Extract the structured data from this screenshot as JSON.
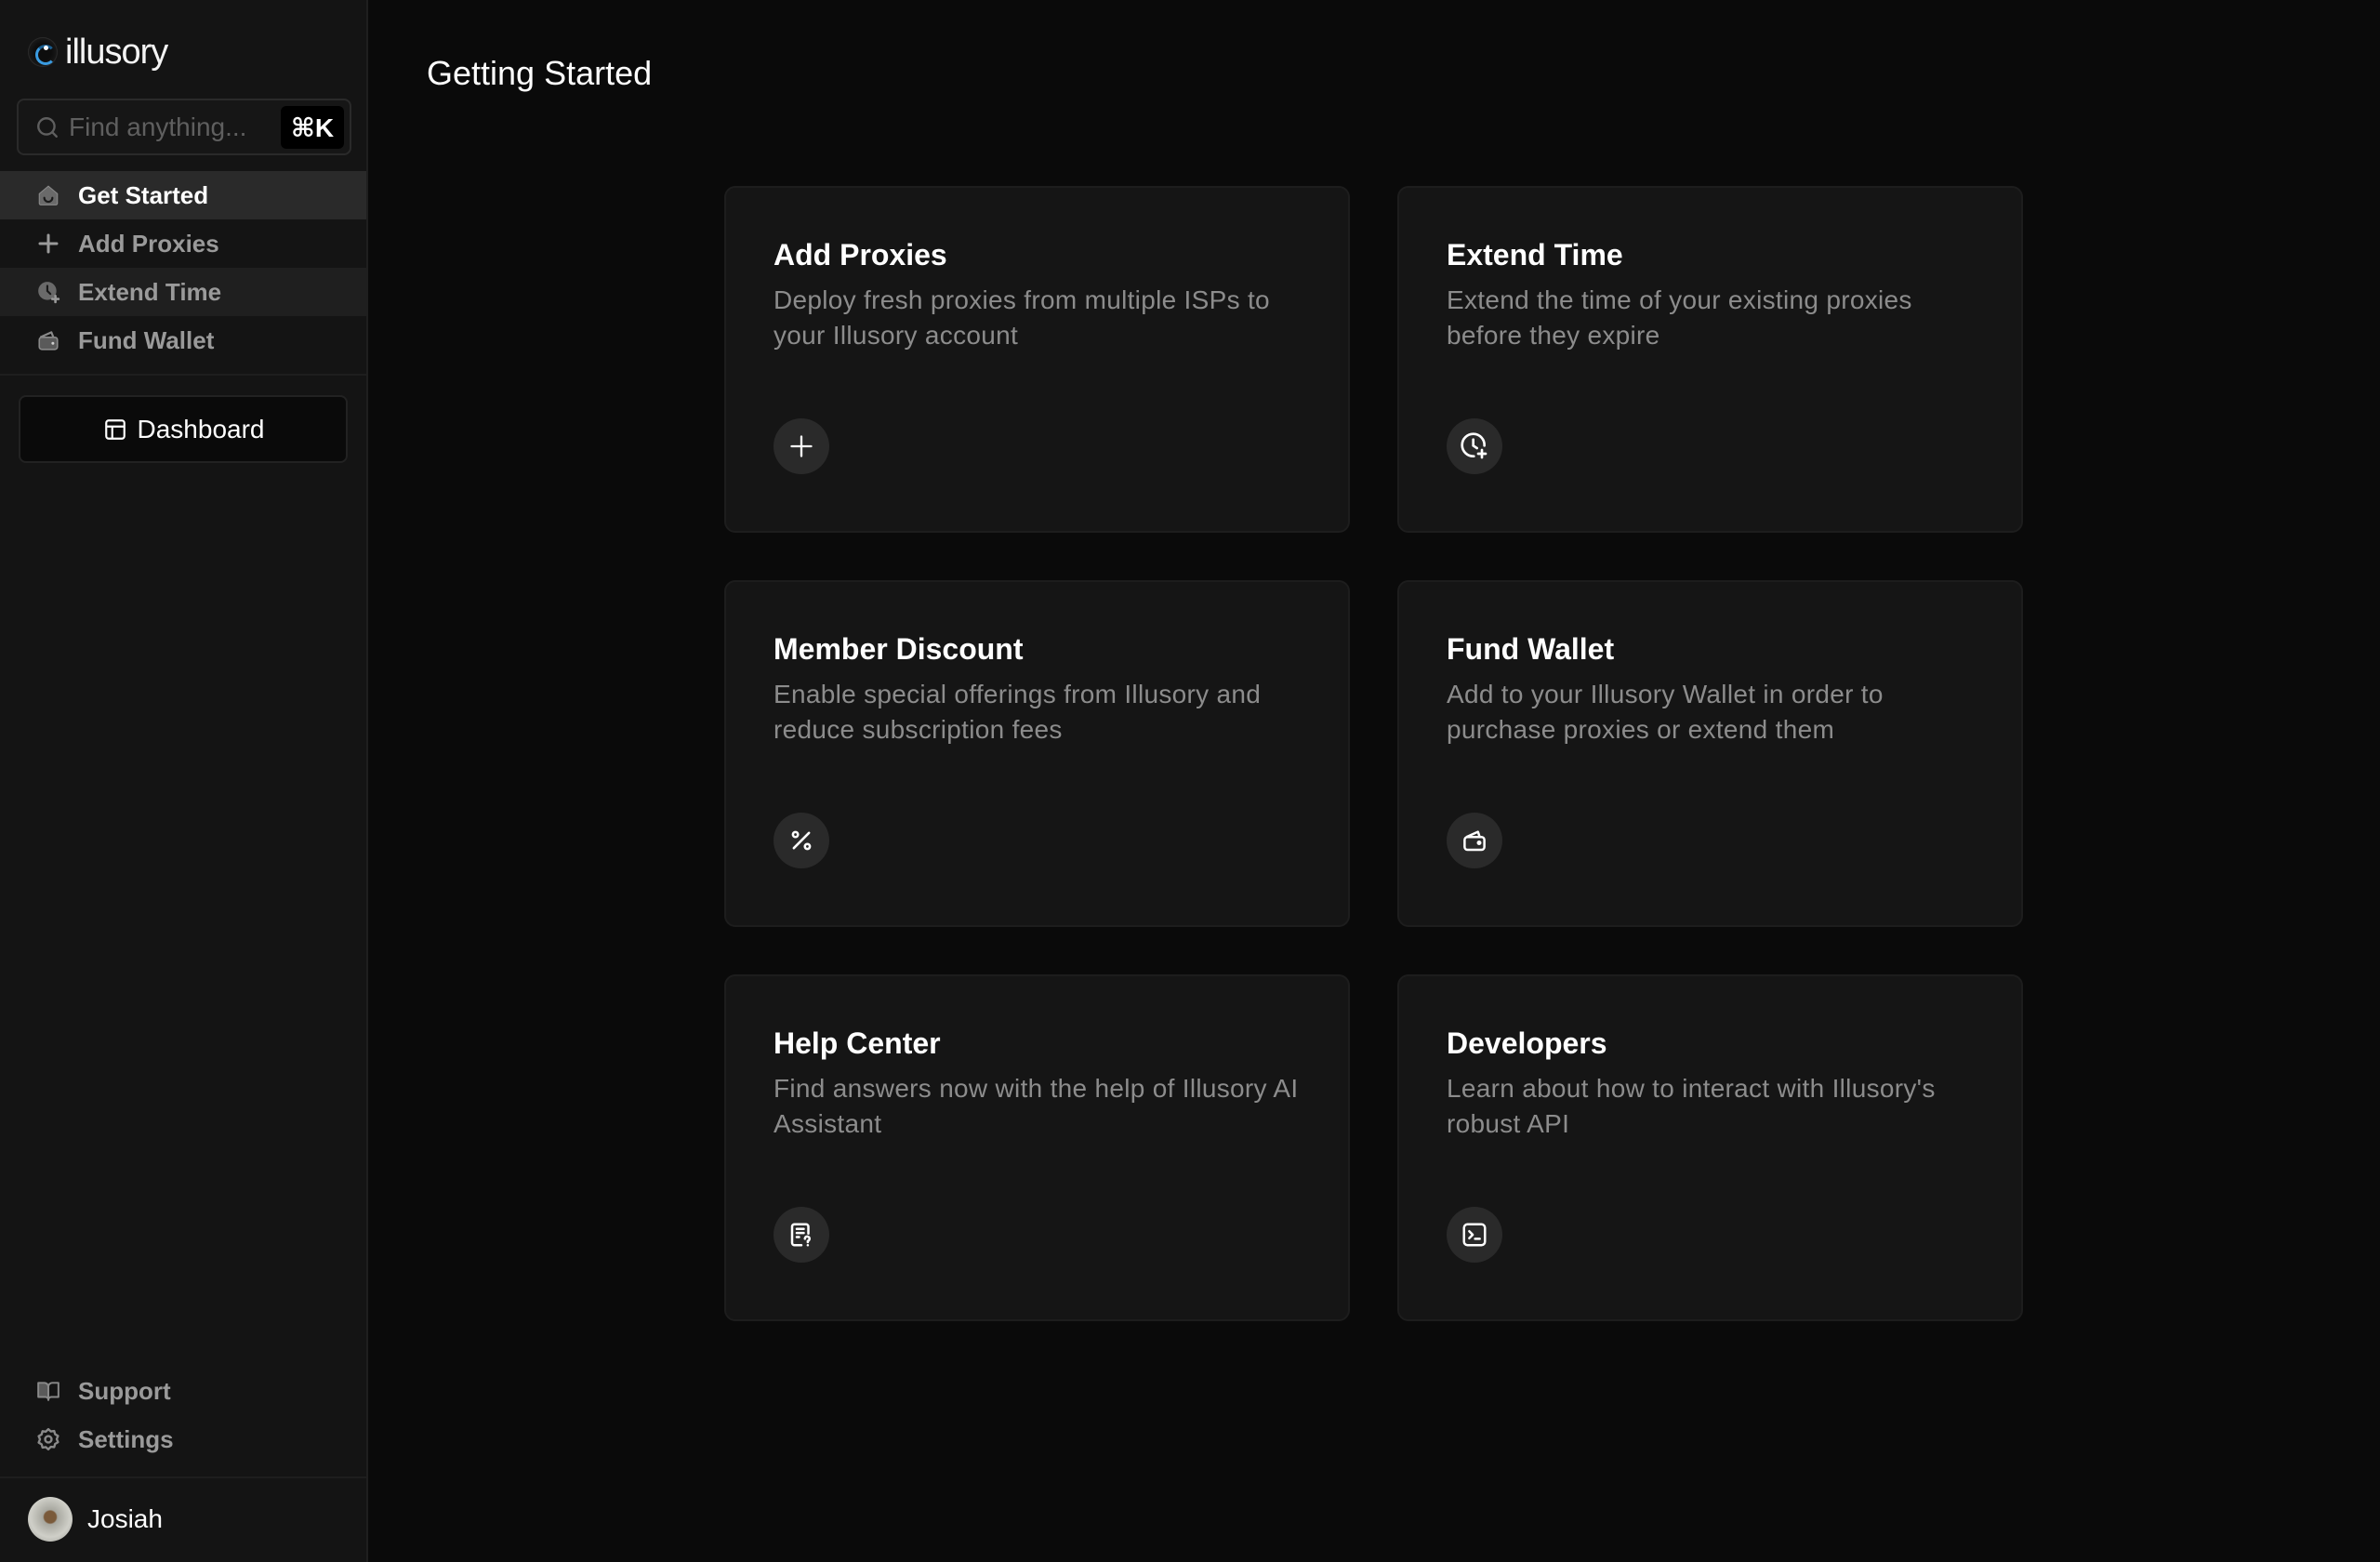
{
  "app": {
    "name": "illusory",
    "logo_icon": "eye-logo-icon"
  },
  "search": {
    "placeholder": "Find anything...",
    "value": "",
    "shortcut": "⌘K",
    "icon": "search-icon"
  },
  "sidebar": {
    "items": [
      {
        "label": "Get Started",
        "icon": "home-smile-icon",
        "active": true
      },
      {
        "label": "Add Proxies",
        "icon": "plus-icon",
        "active": false
      },
      {
        "label": "Extend Time",
        "icon": "clock-plus-icon",
        "active": false
      },
      {
        "label": "Fund Wallet",
        "icon": "wallet-icon",
        "active": false
      }
    ],
    "dashboard_button": {
      "label": "Dashboard",
      "icon": "layout-icon"
    },
    "bottom_items": [
      {
        "label": "Support",
        "icon": "book-open-icon"
      },
      {
        "label": "Settings",
        "icon": "gear-icon"
      }
    ],
    "user": {
      "name": "Josiah",
      "avatar": "user-avatar"
    }
  },
  "main": {
    "title": "Getting Started",
    "cards": [
      {
        "title": "Add Proxies",
        "description": "Deploy fresh proxies from multiple ISPs to your Illusory account",
        "icon": "plus-icon"
      },
      {
        "title": "Extend Time",
        "description": "Extend the time of your existing proxies before they expire",
        "icon": "clock-plus-icon"
      },
      {
        "title": "Member Discount",
        "description": "Enable special offerings from Illusory and reduce subscription fees",
        "icon": "percent-icon"
      },
      {
        "title": "Fund Wallet",
        "description": "Add to your Illusory Wallet in order to purchase proxies or extend them",
        "icon": "wallet-icon"
      },
      {
        "title": "Help Center",
        "description": "Find answers now with the help of Illusory AI Assistant",
        "icon": "file-question-icon"
      },
      {
        "title": "Developers",
        "description": "Learn about how to interact with Illusory's robust API",
        "icon": "terminal-icon"
      }
    ]
  },
  "colors": {
    "sidebar_bg": "#141414",
    "main_bg": "#0a0a0a",
    "card_bg": "#151515",
    "active_item_bg": "#2a2a2a",
    "logo_accent": "#3a9be0",
    "muted_text": "#8c8c8c"
  }
}
